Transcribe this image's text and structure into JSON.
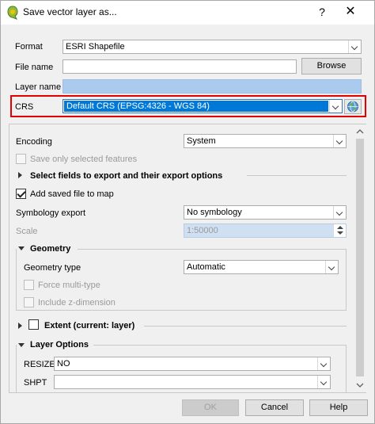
{
  "window": {
    "title": "Save vector layer as...",
    "help_glyph": "?",
    "close_glyph": "✕"
  },
  "form": {
    "format_label": "Format",
    "format_value": "ESRI Shapefile",
    "file_name_label": "File name",
    "file_name_value": "",
    "browse_label": "Browse",
    "layer_name_label": "Layer name",
    "crs_label": "CRS",
    "crs_value": "Default CRS (EPSG:4326 - WGS 84)"
  },
  "options": {
    "encoding_label": "Encoding",
    "encoding_value": "System",
    "save_selected_label": "Save only selected features",
    "select_fields_label": "Select fields to export and their export options",
    "add_saved_label": "Add saved file to map",
    "symbology_label": "Symbology export",
    "symbology_value": "No symbology",
    "scale_label": "Scale",
    "scale_value": "1:50000",
    "geometry_label": "Geometry",
    "geometry_type_label": "Geometry type",
    "geometry_type_value": "Automatic",
    "force_multi_label": "Force multi-type",
    "include_z_label": "Include z-dimension",
    "extent_label": "Extent (current: layer)",
    "layer_options_label": "Layer Options",
    "resize_label": "RESIZE",
    "resize_value": "NO",
    "shpt_label": "SHPT",
    "shpt_value": ""
  },
  "footer": {
    "ok_label": "OK",
    "cancel_label": "Cancel",
    "help_label": "Help"
  },
  "colors": {
    "selection": "#0078d7",
    "highlight_border": "#e30000",
    "layer_name_bg": "#aacbee"
  }
}
